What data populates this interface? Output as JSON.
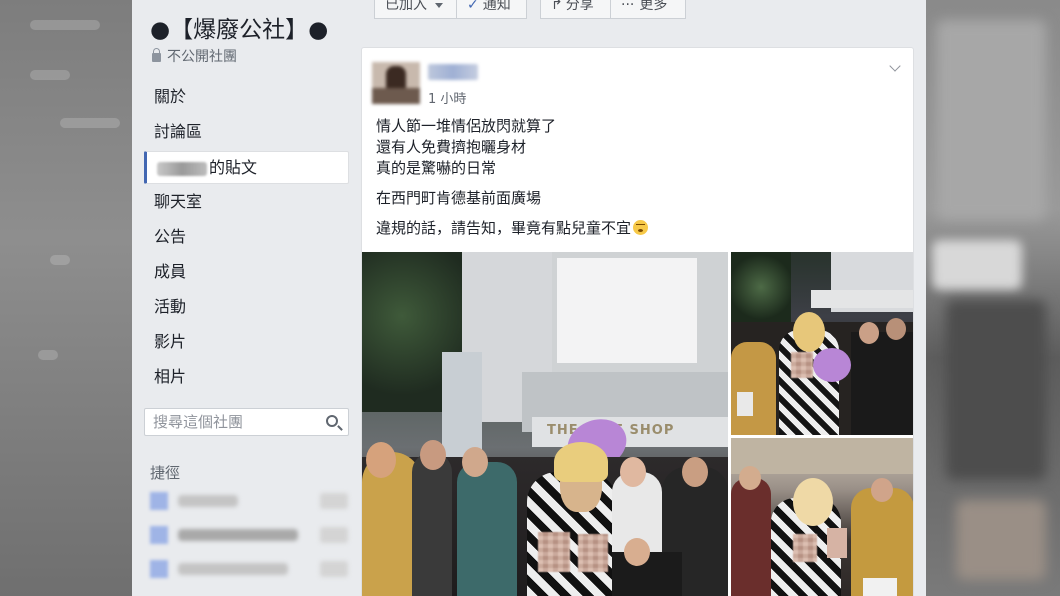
{
  "group": {
    "title": "●【爆廢公社】●",
    "privacy_label": "不公開社團"
  },
  "nav": {
    "items": [
      {
        "label": "關於"
      },
      {
        "label": "討論區"
      },
      {
        "label": "的貼文",
        "active": true
      },
      {
        "label": "聊天室"
      },
      {
        "label": "公告"
      },
      {
        "label": "成員"
      },
      {
        "label": "活動"
      },
      {
        "label": "影片"
      },
      {
        "label": "相片"
      }
    ]
  },
  "search": {
    "placeholder": "搜尋這個社團"
  },
  "shortcuts": {
    "label": "捷徑"
  },
  "toolbar": {
    "joined_label": "已加入",
    "notify_label": "通知",
    "share_label": "分享",
    "more_label": "更多"
  },
  "post": {
    "timestamp": "1 小時",
    "lines": [
      "情人節一堆情侶放閃就算了",
      "還有人免費擠抱曬身材",
      "真的是驚嚇的日常",
      "在西門町肯德基前面廣場",
      "違規的話，請告知，畢竟有點兒童不宜"
    ]
  },
  "photos": {
    "storefront_text": "THE FACE SHOP"
  },
  "colors": {
    "facebook_bg": "#e9ebee",
    "accent_blue": "#4267b2",
    "card_border": "#dddfe2"
  }
}
